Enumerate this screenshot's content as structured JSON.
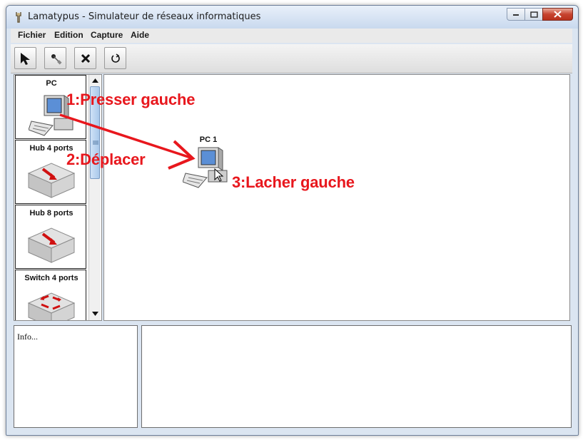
{
  "window": {
    "title": "Lamatypus - Simulateur de réseaux informatiques",
    "buttons": {
      "minimize": "minimize",
      "maximize": "maximize",
      "close": "close"
    }
  },
  "menu": {
    "items": [
      {
        "label": "Fichier"
      },
      {
        "label": "Edition"
      },
      {
        "label": "Capture"
      },
      {
        "label": "Aide"
      }
    ]
  },
  "toolbar": {
    "buttons": [
      {
        "icon": "pointer-arrow-icon"
      },
      {
        "icon": "cable-connect-icon"
      },
      {
        "icon": "delete-x-icon"
      },
      {
        "icon": "refresh-icon"
      }
    ]
  },
  "palette": {
    "items": [
      {
        "label": "PC",
        "icon": "pc-icon"
      },
      {
        "label": "Hub 4 ports",
        "icon": "hub-icon"
      },
      {
        "label": "Hub 8 ports",
        "icon": "hub-icon"
      },
      {
        "label": "Switch 4 ports",
        "icon": "switch-icon"
      }
    ]
  },
  "canvas": {
    "nodes": [
      {
        "label": "PC 1",
        "icon": "pc-icon"
      }
    ]
  },
  "info_panel": {
    "text": "Info..."
  },
  "annotations": {
    "step1": "1:Presser gauche",
    "step2": "2:Déplacer",
    "step3": "3:Lacher gauche"
  },
  "colors": {
    "annotation": "#e8171d",
    "device_red": "#d01010",
    "window_frame": "#dbe5f1"
  }
}
